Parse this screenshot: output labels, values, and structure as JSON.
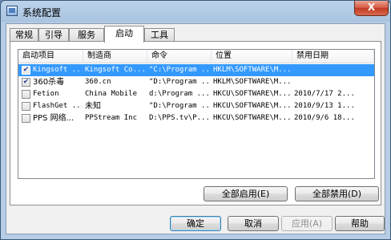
{
  "window": {
    "title": "系统配置",
    "close_glyph": "X"
  },
  "tabs": [
    {
      "label": "常规"
    },
    {
      "label": "引导"
    },
    {
      "label": "服务"
    },
    {
      "label": "启动"
    },
    {
      "label": "工具"
    }
  ],
  "active_tab": "启动",
  "table": {
    "columns": [
      "启动项目",
      "制造商",
      "命令",
      "位置",
      "禁用日期"
    ],
    "rows": [
      {
        "checked": true,
        "selected": true,
        "item": "Kingsoft ...",
        "maker": "Kingsoft Co...",
        "command": "\"C:\\Program ...",
        "location": "HKLM\\SOFTWARE\\M...",
        "disabled_date": ""
      },
      {
        "checked": true,
        "selected": false,
        "item": "360杀毒",
        "maker": "360.cn",
        "command": "\"D:\\Program ...",
        "location": "HKLM\\SOFTWARE\\M...",
        "disabled_date": ""
      },
      {
        "checked": false,
        "selected": false,
        "item": "Fetion",
        "maker": "China Mobile",
        "command": "d:\\Program ...",
        "location": "HKCU\\SOFTWARE\\M...",
        "disabled_date": "2010/7/17 2..."
      },
      {
        "checked": false,
        "selected": false,
        "item": "FlashGet ...",
        "maker": "未知",
        "command": "\"D:\\Program ...",
        "location": "HKCU\\SOFTWARE\\M...",
        "disabled_date": "2010/9/13 1..."
      },
      {
        "checked": false,
        "selected": false,
        "item": "PPS 网络...",
        "maker": "PPStream Inc",
        "command": "D:\\PPS.tv\\P...",
        "location": "HKCU\\SOFTWARE\\M...",
        "disabled_date": "2010/9/6 18..."
      }
    ]
  },
  "panel_buttons": {
    "enable_all": "全部启用(E)",
    "disable_all": "全部禁用(D)"
  },
  "dialog_buttons": {
    "ok": "确定",
    "cancel": "取消",
    "apply": "应用(A)",
    "help": "帮助"
  }
}
